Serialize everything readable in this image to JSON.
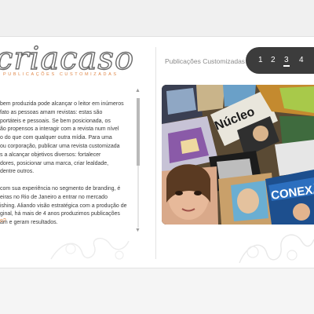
{
  "brand": {
    "logo_text": "criacaso",
    "tagline": "PUBLICAÇÕES CUSTOMIZADAS"
  },
  "body": {
    "lines": [
      "bem produzida pode alcançar o leitor em inúmeros",
      "fato as pessoas amam revistas: estas são",
      "portáteis e pessoais. Se bem posicionada, os",
      "ão propensos a interagir com a revista num nível",
      "o do que com qualquer outra mídia. Para uma",
      "ou corporação, publicar uma revista customizada",
      "s a alcançar objetivos diversos: fortalecer",
      "dores, posicionar uma marca, criar lealdade,",
      "dentre outros."
    ],
    "lines2": [
      "com sua experiência no segmento de branding, é",
      "eiras no Rio de Janeiro a entrar no mercado",
      "ishing. Aliando visão estratégica com a produção de",
      "ginal, há mais de 4 anos produzimos publicações",
      "am e geram resultados."
    ],
    "more_link": "o?"
  },
  "scrollbar": {
    "up_arrow": "▲",
    "down_arrow": "▼"
  },
  "portfolio": {
    "section_title": "Publicações Customizadas",
    "pages": [
      "1",
      "2",
      "3",
      "4"
    ],
    "active_page": "3",
    "collage_texts": {
      "nuclear": "Núcleo",
      "conex": "CONEXÃO"
    }
  },
  "colors": {
    "accent": "#e0884a",
    "pager_bg": "#3c3c3c",
    "text": "#3a3a3a"
  }
}
